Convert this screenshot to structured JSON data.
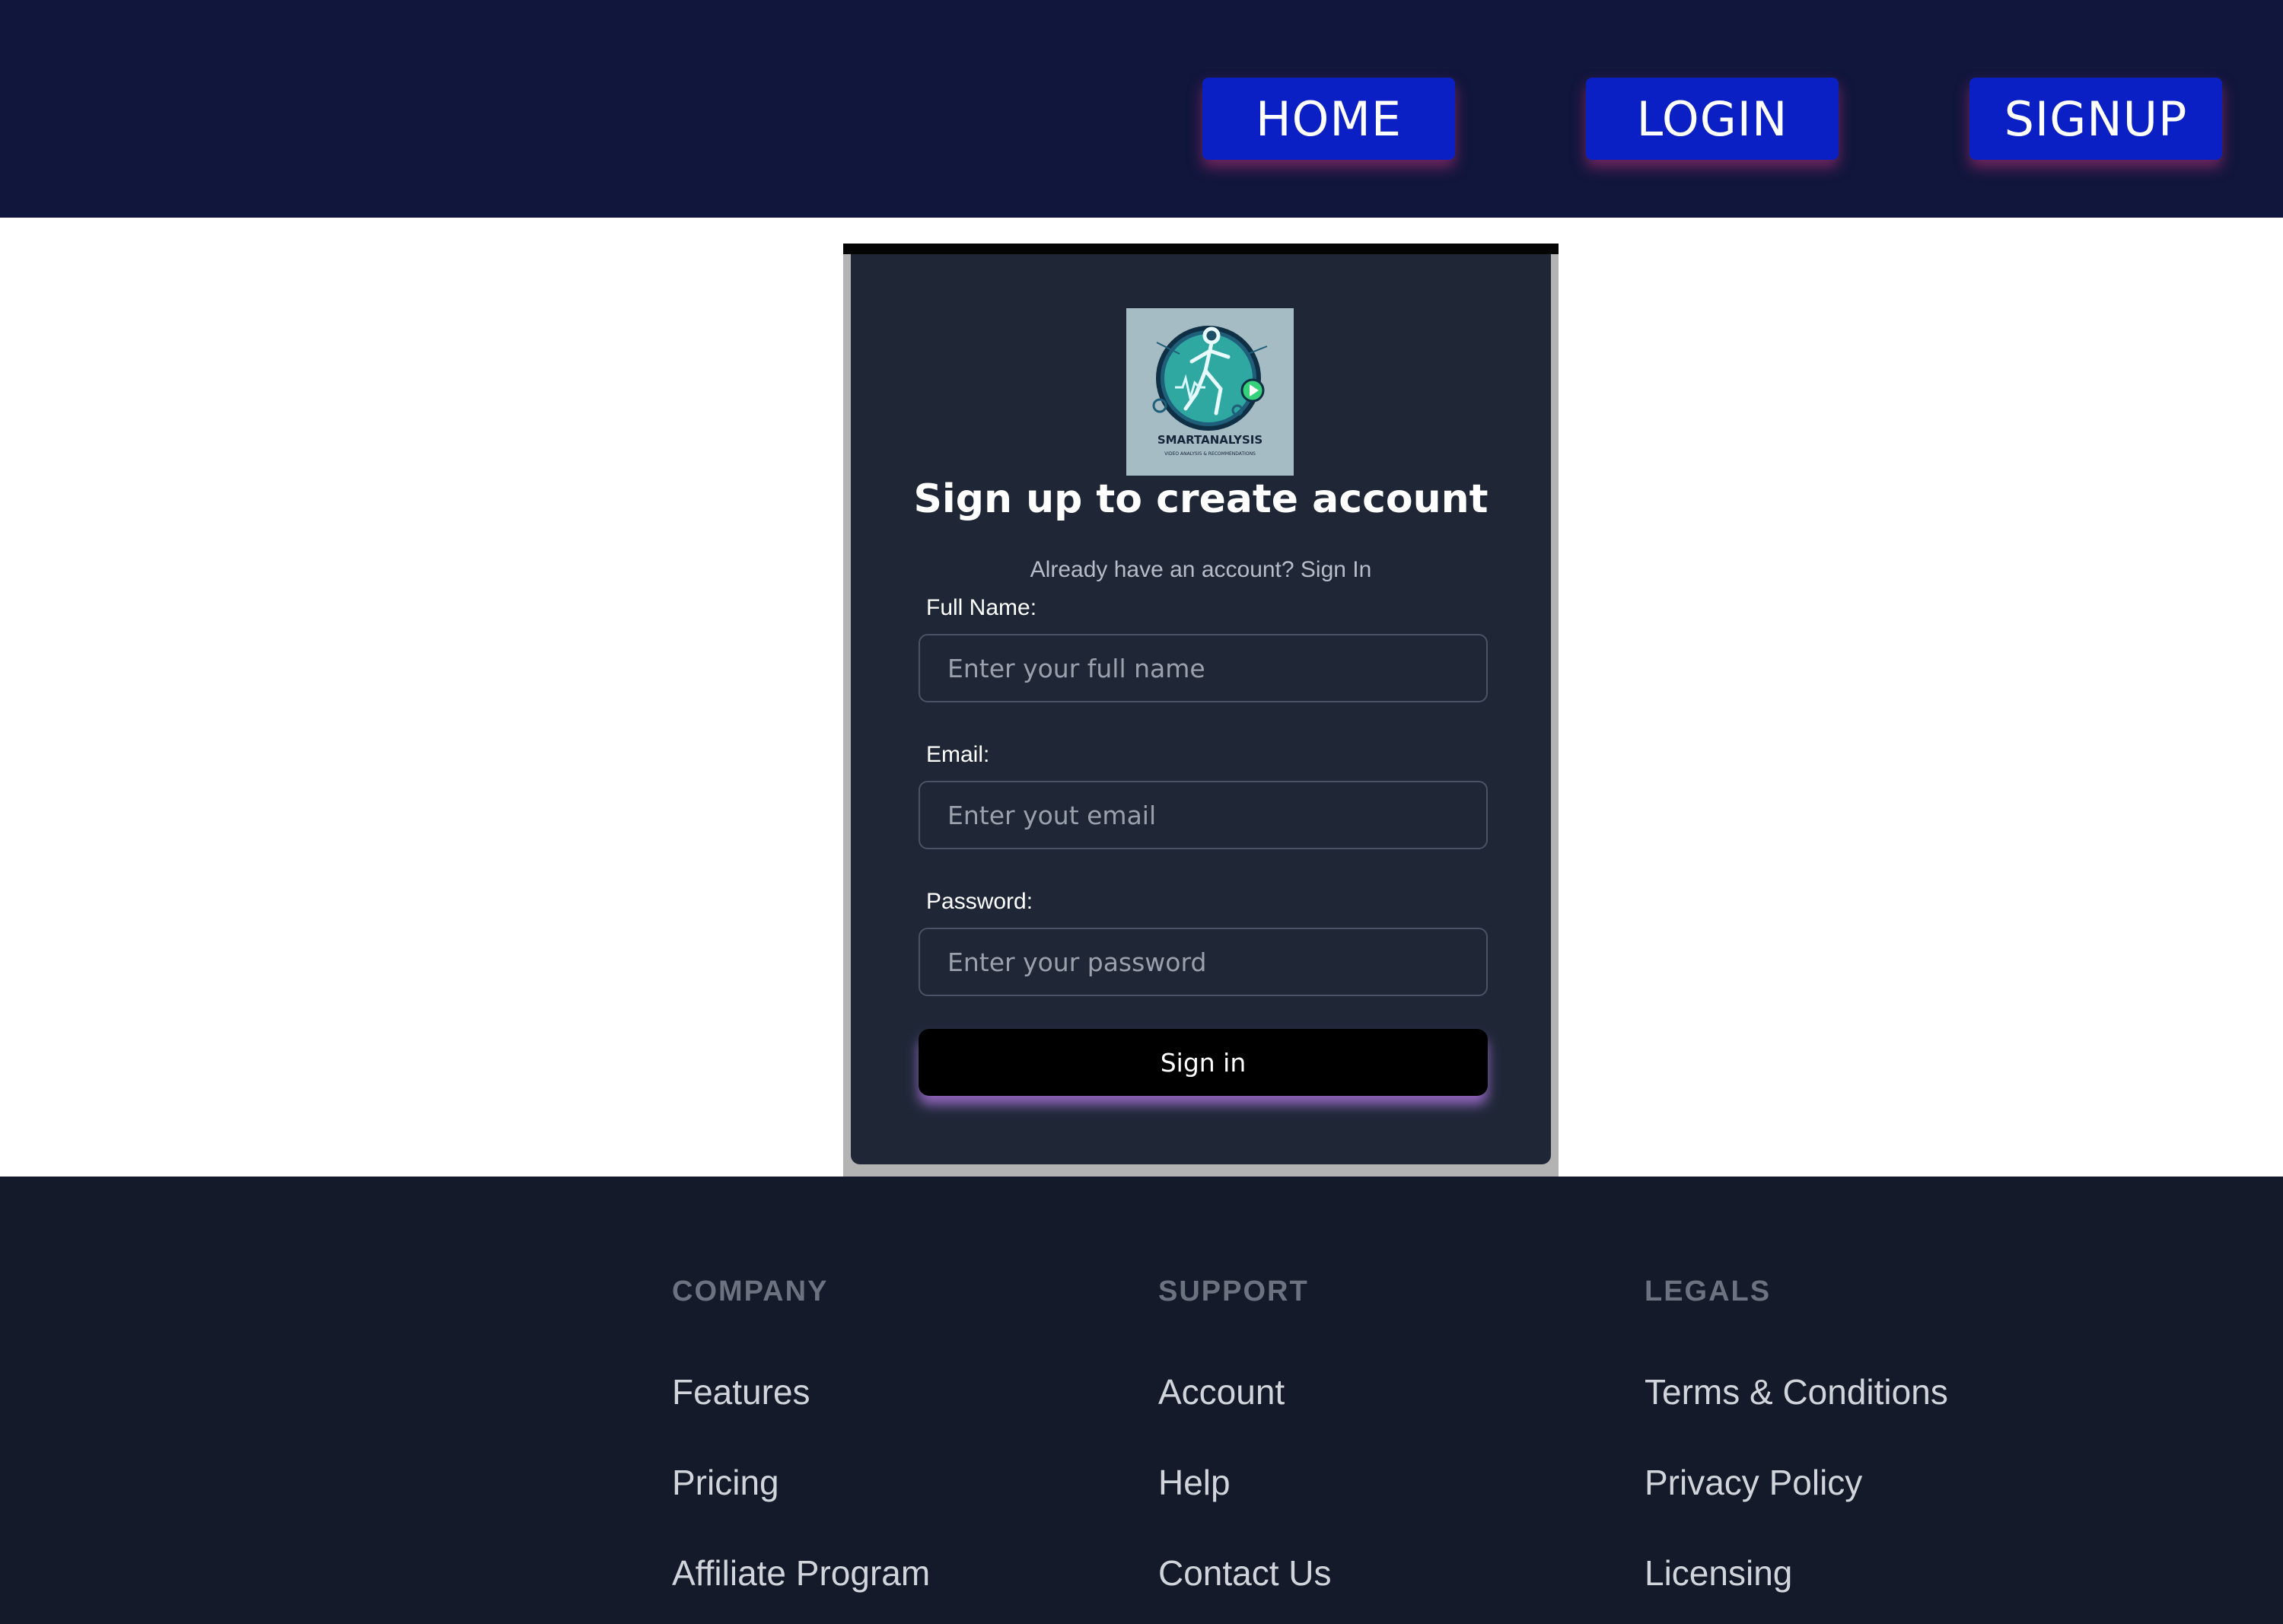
{
  "nav": {
    "home": "HOME",
    "login": "LOGIN",
    "signup": "SIGNUP"
  },
  "logo": {
    "text": "SMARTANALYSIS",
    "tagline": "VIDEO ANALYSIS & RECOMMENDATIONS"
  },
  "form": {
    "title": "Sign up to create account",
    "subtitle_prefix": "Already have an account?",
    "subtitle_link": "Sign In",
    "fields": [
      {
        "label": "Full Name:",
        "placeholder": "Enter your full name"
      },
      {
        "label": "Email:",
        "placeholder": "Enter yout email"
      },
      {
        "label": "Password:",
        "placeholder": "Enter your password"
      }
    ],
    "submit_label": "Sign in"
  },
  "footer": {
    "columns": [
      {
        "heading": "COMPANY",
        "links": [
          "Features",
          "Pricing",
          "Affiliate Program"
        ]
      },
      {
        "heading": "SUPPORT",
        "links": [
          "Account",
          "Help",
          "Contact Us"
        ]
      },
      {
        "heading": "LEGALS",
        "links": [
          "Terms & Conditions",
          "Privacy Policy",
          "Licensing"
        ]
      }
    ]
  },
  "colors": {
    "header_bg": "#11163d",
    "nav_button": "#0a20c4",
    "card_bg": "#1f2737",
    "footer_bg": "#141a29",
    "submit_glow": "#b478e6"
  }
}
